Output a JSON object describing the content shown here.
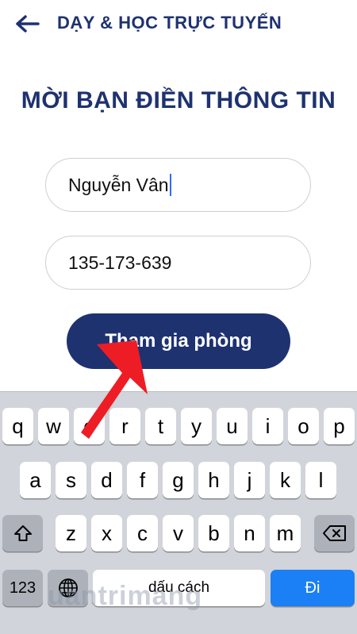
{
  "header": {
    "back_icon": "arrow-left-icon",
    "title": "DẠY & HỌC TRỰC TUYẾN"
  },
  "page_title": "MỜI BẠN ĐIỀN THÔNG TIN",
  "form": {
    "name_value": "Nguyễn Vân",
    "id_value": "135-173-639",
    "join_label": "Tham gia phòng"
  },
  "keyboard": {
    "row1": [
      "q",
      "w",
      "e",
      "r",
      "t",
      "y",
      "u",
      "i",
      "o",
      "p"
    ],
    "row2": [
      "a",
      "s",
      "d",
      "f",
      "g",
      "h",
      "j",
      "k",
      "l"
    ],
    "row3": [
      "z",
      "x",
      "c",
      "v",
      "b",
      "n",
      "m"
    ],
    "shift_icon": "shift-icon",
    "delete_icon": "backspace-icon",
    "numbers_label": "123",
    "globe_icon": "globe-icon",
    "space_label": "dấu cách",
    "go_label": "Đi"
  },
  "watermark": "uantrimang",
  "colors": {
    "brand": "#1e3270",
    "go_key": "#1b7ff5",
    "annotation_arrow": "#ee1c24"
  }
}
